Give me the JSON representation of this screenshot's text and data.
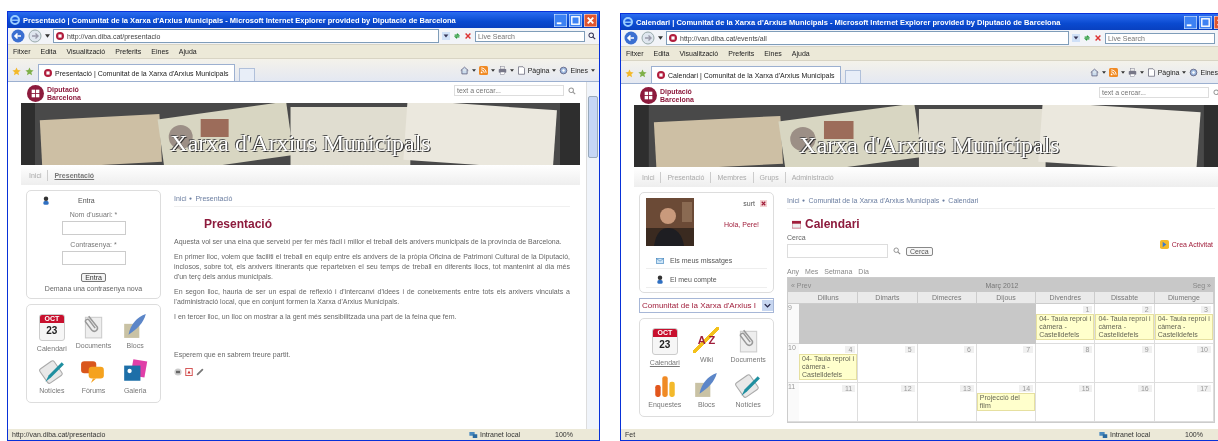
{
  "windows": [
    {
      "title": "Presentació | Comunitat de la Xarxa d'Arxius Municipals - Microsoft Internet Explorer provided by Diputació de Barcelona",
      "url": "http://van.diba.cat/presentacio",
      "search_placeholder": "Live Search",
      "menu": [
        "Fitxer",
        "Edita",
        "Visualització",
        "Preferits",
        "Eines",
        "Ajuda"
      ],
      "tab": "Presentació | Comunitat de la Xarxa d'Arxius Municipals",
      "toolbar": [
        "Pàgina",
        "Eines"
      ],
      "scrollbar": true,
      "site": {
        "logo": [
          "Diputació",
          "Barcelona"
        ],
        "search_placeholder": "text a cercar...",
        "banner_title": "Xarxa d'Arxius Municipals",
        "nav": [
          {
            "label": "Inici",
            "selected": false
          },
          {
            "label": "Presentació",
            "selected": true
          }
        ],
        "breadcrumb": [
          "Inici",
          "Presentació"
        ],
        "sidebar": {
          "kind": "login",
          "title": "Entra",
          "fields": [
            {
              "label": "Nom d'usuari: *"
            },
            {
              "label": "Contrasenya: *"
            }
          ],
          "button": "Entra",
          "link": "Demana una contrasenya nova",
          "apps": [
            {
              "kind": "calendar",
              "label": "Calendari",
              "month": "OCT",
              "day": "23",
              "selected": false
            },
            {
              "kind": "clip",
              "label": "Documents",
              "selected": false
            },
            {
              "kind": "quill",
              "label": "Blocs",
              "selected": false
            },
            {
              "kind": "pen",
              "label": "Notícies",
              "selected": false
            },
            {
              "kind": "bubbles",
              "label": "Fòrums",
              "selected": false
            },
            {
              "kind": "photos",
              "label": "Galeria",
              "selected": false
            }
          ]
        },
        "main": {
          "kind": "page",
          "title": "Presentació",
          "paragraphs": [
            "Aquesta vol ser una eina que serveixi per fer més fàcil i millor el treball dels arxivers municipals de la província de Barcelona.",
            "En primer lloc, volem que faciliti el treball en equip entre els arxivers de la pròpia Oficina de Patrimoni Cultural de la Diputació, inclosos, sobre tot, els arxivers itinerants que reparteixen el seu temps de treball en diferents llocs, tot mantenint al dia més d'un terç dels arxius municipals.",
            "En segon lloc, hauria de ser un espai de reflexió i d'intercanvi d'idees i de coneixements entre tots els arxivers vinculats a l'administració local, que en conjunt formen la Xarxa d'Arxius Municipals.",
            "I en tercer lloc, un lloc on mostrar a la gent més sensibilitzada una part de la feina que fem."
          ],
          "closing": "Esperem que en sabrem treure partit."
        }
      },
      "status": {
        "text": "http://van.diba.cat/presentacio",
        "zone": "Intranet local",
        "zoom": "100%"
      }
    },
    {
      "title": "Calendari | Comunitat de la Xarxa d'Arxius Municipals - Microsoft Internet Explorer provided by Diputació de Barcelona",
      "url": "http://van.diba.cat/events/all",
      "search_placeholder": "Live Search",
      "menu": [
        "Fitxer",
        "Edita",
        "Visualització",
        "Preferits",
        "Eines",
        "Ajuda"
      ],
      "tab": "Calendari | Comunitat de la Xarxa d'Arxius Municipals",
      "toolbar": [
        "Pàgina",
        "Eines"
      ],
      "site": {
        "logo": [
          "Diputació",
          "Barcelona"
        ],
        "search_placeholder": "text a cercar...",
        "banner_title": "Xarxa d'Arxius Municipals",
        "nav": [
          {
            "label": "Inici",
            "selected": false
          },
          {
            "label": "Presentació",
            "selected": false
          },
          {
            "label": "Membres",
            "selected": false
          },
          {
            "label": "Grups",
            "selected": false
          },
          {
            "label": "Administració",
            "selected": false
          }
        ],
        "breadcrumb": [
          "Inici",
          "Comunitat de la Xarxa d'Arxius Municipals",
          "Calendari"
        ],
        "sidebar": {
          "kind": "user",
          "logout": "surt",
          "greeting": "Hola, Pere!",
          "links": [
            "Els meus missatges",
            "El meu compte"
          ],
          "group_select": "Comunitat de la Xarxa d'Arxius I",
          "apps": [
            {
              "kind": "calendar",
              "label": "Calendari",
              "month": "OCT",
              "day": "23",
              "selected": true
            },
            {
              "kind": "wiki",
              "label": "Wiki",
              "glyph": "A Z",
              "selected": false
            },
            {
              "kind": "clip",
              "label": "Documents",
              "selected": false
            },
            {
              "kind": "bars",
              "label": "Enquestes",
              "selected": false
            },
            {
              "kind": "quill",
              "label": "Blocs",
              "selected": false
            },
            {
              "kind": "pen",
              "label": "Notícies",
              "selected": false
            }
          ]
        },
        "main": {
          "kind": "calendar",
          "title": "Calendari",
          "search_label": "Cerca",
          "search_button": "Cerca",
          "create": "Crea Activitat",
          "views": [
            "Any",
            "Mes",
            "Setmana",
            "Dia"
          ],
          "prev": "« Prev",
          "next": "Seg »",
          "month": "Març 2012",
          "weekdays": [
            "Dilluns",
            "Dimarts",
            "Dimecres",
            "Dijous",
            "Divendres",
            "Dissabte",
            "Diumenge"
          ],
          "weeks": [
            {
              "number": "9",
              "days": [
                {
                  "kind": "blank"
                },
                {
                  "kind": "blank"
                },
                {
                  "kind": "blank"
                },
                {
                  "kind": "blank"
                },
                {
                  "kind": "day",
                  "day": "1",
                  "events": [
                    "04- Taula reproi i càmera - Castelldefels"
                  ]
                },
                {
                  "kind": "day",
                  "day": "2",
                  "events": [
                    "04- Taula reproi i càmera - Castelldefels"
                  ]
                },
                {
                  "kind": "day",
                  "day": "3",
                  "events": [
                    "04- Taula reproi i càmera - Castelldefels"
                  ]
                }
              ]
            },
            {
              "number": "10",
              "days": [
                {
                  "kind": "day",
                  "day": "4",
                  "events": [
                    "04- Taula reproi i càmera - Castelldefels"
                  ]
                },
                {
                  "kind": "day",
                  "day": "5"
                },
                {
                  "kind": "day",
                  "day": "6"
                },
                {
                  "kind": "day",
                  "day": "7"
                },
                {
                  "kind": "day",
                  "day": "8"
                },
                {
                  "kind": "day",
                  "day": "9"
                },
                {
                  "kind": "day",
                  "day": "10"
                }
              ]
            },
            {
              "number": "11",
              "days": [
                {
                  "kind": "day",
                  "day": "11"
                },
                {
                  "kind": "day",
                  "day": "12"
                },
                {
                  "kind": "day",
                  "day": "13"
                },
                {
                  "kind": "day",
                  "day": "14",
                  "events": [
                    "Projecció del film"
                  ]
                },
                {
                  "kind": "day",
                  "day": "15"
                },
                {
                  "kind": "day",
                  "day": "16"
                },
                {
                  "kind": "day",
                  "day": "17"
                }
              ]
            }
          ]
        }
      },
      "status": {
        "text": "Fet",
        "zone": "Intranet local",
        "zoom": "100%"
      }
    }
  ]
}
